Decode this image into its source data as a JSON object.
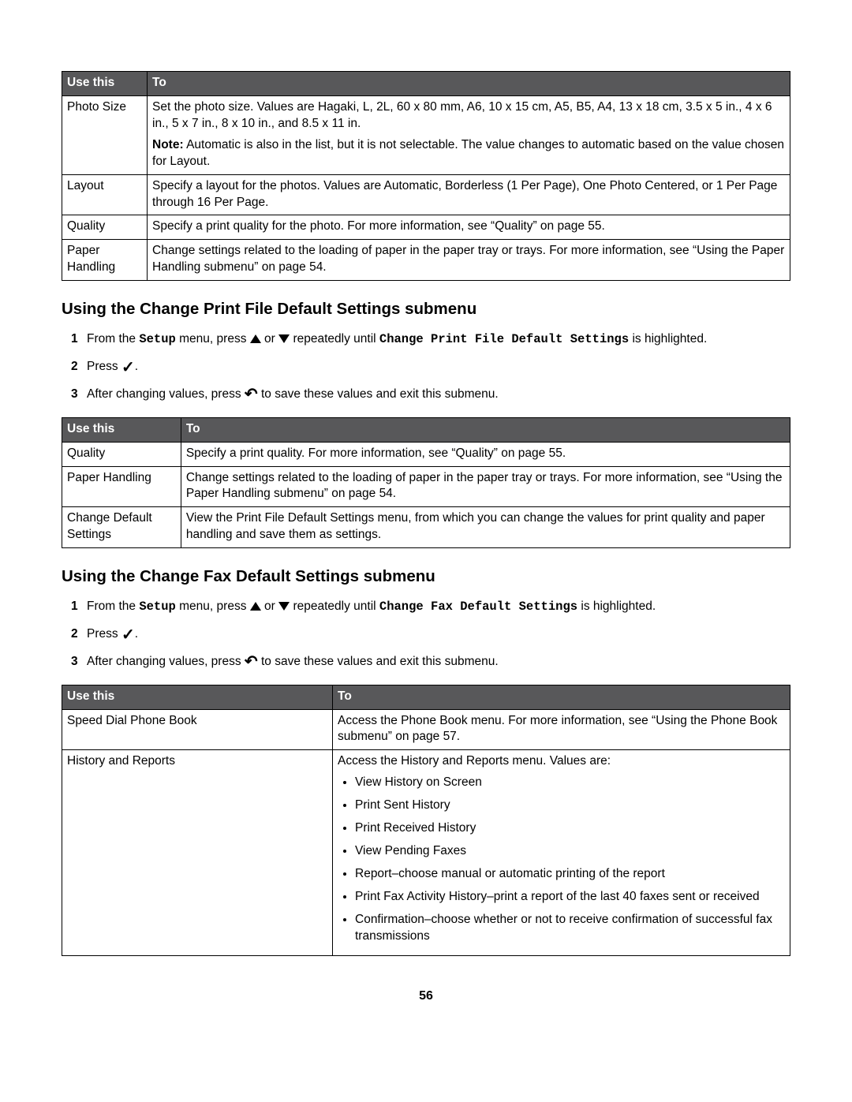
{
  "table1": {
    "header": {
      "col1": "Use this",
      "col2": "To"
    },
    "rows": [
      {
        "c1": "Photo Size",
        "c2_main": "Set the photo size. Values are Hagaki, L, 2L, 60 x 80 mm, A6, 10 x 15 cm, A5, B5, A4, 13 x 18 cm, 3.5 x 5 in., 4 x 6 in., 5 x 7 in., 8 x 10 in., and 8.5 x 11 in.",
        "c2_note_label": "Note:",
        "c2_note_text": " Automatic is also in the list, but it is not selectable. The value changes to automatic based on the value chosen for Layout."
      },
      {
        "c1": "Layout",
        "c2_main": "Specify a layout for the photos. Values are Automatic, Borderless (1 Per Page), One Photo Centered, or 1 Per Page through 16 Per Page."
      },
      {
        "c1": "Quality",
        "c2_main": "Specify a print quality for the photo. For more information, see “Quality” on page 55."
      },
      {
        "c1": "Paper Handling",
        "c2_main": "Change settings related to the loading of paper in the paper tray or trays. For more information, see “Using the Paper Handling submenu” on page 54."
      }
    ]
  },
  "section1": {
    "heading": "Using the Change Print File Default Settings submenu",
    "step1": {
      "pre": "From the ",
      "setup": "Setup",
      "mid1": " menu, press ",
      "mid2": " or ",
      "mid3": " repeatedly until ",
      "target": "Change Print File Default Settings",
      "post": " is highlighted."
    },
    "step2": {
      "pre": "Press ",
      "post": "."
    },
    "step3": {
      "pre": "After changing values, press ",
      "post": " to save these values and exit this submenu."
    }
  },
  "table2": {
    "header": {
      "col1": "Use this",
      "col2": "To"
    },
    "rows": [
      {
        "c1": "Quality",
        "c2": "Specify a print quality. For more information, see “Quality” on page 55."
      },
      {
        "c1": "Paper Handling",
        "c2": "Change settings related to the loading of paper in the paper tray or trays. For more information, see “Using the Paper Handling submenu” on page 54."
      },
      {
        "c1": "Change Default Settings",
        "c2": "View the Print File Default Settings menu, from which you can change the values for print quality and paper handling and save them as settings."
      }
    ]
  },
  "section2": {
    "heading": "Using the Change Fax Default Settings submenu",
    "step1": {
      "pre": "From the ",
      "setup": "Setup",
      "mid1": " menu, press ",
      "mid2": " or ",
      "mid3": " repeatedly until ",
      "target": "Change Fax Default Settings",
      "post": " is highlighted."
    },
    "step2": {
      "pre": "Press ",
      "post": "."
    },
    "step3": {
      "pre": "After changing values, press ",
      "post": " to save these values and exit this submenu."
    }
  },
  "table3": {
    "header": {
      "col1": "Use this",
      "col2": "To"
    },
    "rows": [
      {
        "c1": "Speed Dial Phone Book",
        "c2": "Access the Phone Book menu. For more information, see “Using the Phone Book submenu” on page 57."
      },
      {
        "c1": "History and Reports",
        "c2_lead": "Access the History and Reports menu. Values are:",
        "bullets": [
          "View History on Screen",
          "Print Sent History",
          "Print Received History",
          "View Pending Faxes",
          "Report–choose manual or automatic printing of the report",
          "Print Fax Activity History–print a report of the last 40 faxes sent or received",
          "Confirmation–choose whether or not to receive confirmation of successful fax transmissions"
        ]
      }
    ]
  },
  "page_number": "56"
}
